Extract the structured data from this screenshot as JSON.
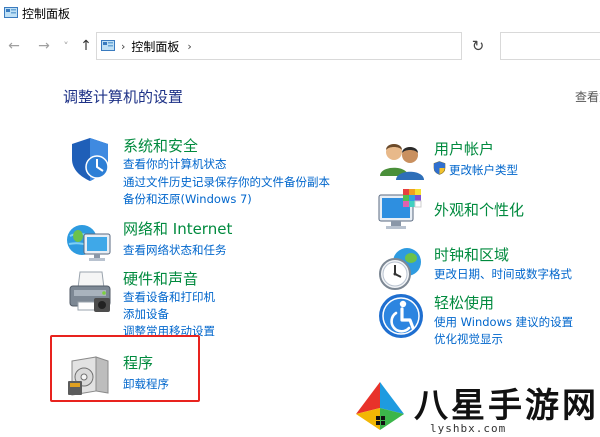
{
  "window": {
    "title": "控制面板"
  },
  "nav": {
    "back_icon": "←",
    "forward_icon": "→",
    "recent_icon": "˅",
    "up_icon": "↑",
    "breadcrumb_sep": "›",
    "breadcrumb": "控制面板",
    "breadcrumb_trail_sep": "›",
    "dropdown_icon": "˅",
    "refresh_icon": "↻"
  },
  "main": {
    "heading": "调整计算机的设置",
    "view_by": "查看方式"
  },
  "categories": {
    "system": {
      "title": "系统和安全",
      "links": [
        "查看你的计算机状态",
        "通过文件历史记录保存你的文件备份副本",
        "备份和还原(Windows 7)"
      ]
    },
    "network": {
      "title": "网络和 Internet",
      "links": [
        "查看网络状态和任务"
      ]
    },
    "hardware": {
      "title": "硬件和声音",
      "links": [
        "查看设备和打印机",
        "添加设备",
        "调整常用移动设置"
      ]
    },
    "programs": {
      "title": "程序",
      "links": [
        "卸载程序"
      ]
    },
    "users": {
      "title": "用户帐户",
      "links": [
        "更改帐户类型"
      ]
    },
    "appearance": {
      "title": "外观和个性化",
      "links": []
    },
    "clock": {
      "title": "时钟和区域",
      "links": [
        "更改日期、时间或数字格式"
      ]
    },
    "ease": {
      "title": "轻松使用",
      "links": [
        "使用 Windows 建议的设置",
        "优化视觉显示"
      ]
    }
  },
  "watermark": {
    "text": "八星手游网",
    "url": "lyshbx.com"
  },
  "colors": {
    "category_title": "#008a3e",
    "link": "#0066cc",
    "heading": "#1e3287",
    "highlight_box": "#e8231e"
  }
}
